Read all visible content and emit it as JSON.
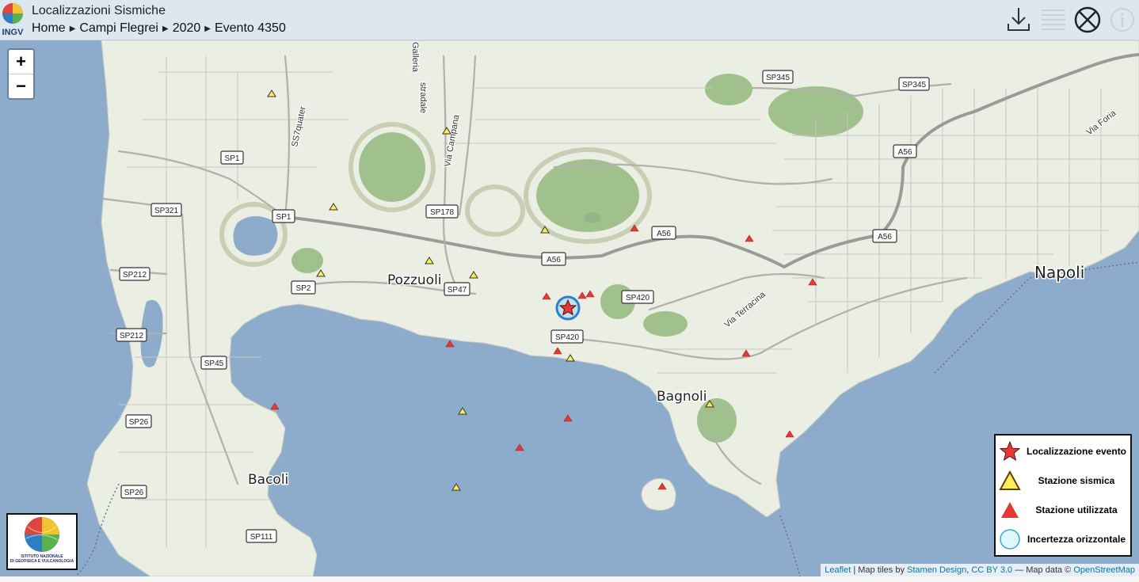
{
  "header": {
    "title": "Localizzazioni Sismiche",
    "logo_text": "INGV",
    "breadcrumb": [
      "Home",
      "Campi Flegrei",
      "2020",
      "Evento 4350"
    ],
    "icons": [
      "download-icon",
      "list-icon",
      "layers-off-icon",
      "info-icon"
    ]
  },
  "map": {
    "zoom_in": "+",
    "zoom_out": "−",
    "places": [
      "Pozzuoli",
      "Napoli",
      "Bagnoli",
      "Bacoli"
    ],
    "streets": [
      "Galleria",
      "stradale",
      "Via Campana",
      "SS7quater",
      "Via Terracina",
      "Via Foria"
    ],
    "roads": [
      "SP345",
      "SP345",
      "SP1",
      "A56",
      "SP321",
      "SP1",
      "SP178",
      "A56",
      "A56",
      "A56",
      "SP212",
      "SP2",
      "SP47",
      "SP420",
      "SP212",
      "SP420",
      "SP45",
      "SP26",
      "SP26",
      "SP111"
    ],
    "colors": {
      "sea": "#8daccb",
      "land": "#ebeee2",
      "hill": "#93b87e",
      "road": "#9a9a9a",
      "event": "#e53935",
      "station": "#ffee58",
      "used": "#e53935",
      "uncertainty": "#c7f2f7"
    }
  },
  "legend": {
    "items": [
      {
        "label": "Localizzazione evento",
        "icon": "star-icon"
      },
      {
        "label": "Stazione sismica",
        "icon": "triangle-yellow-icon"
      },
      {
        "label": "Stazione utilizzata",
        "icon": "triangle-red-icon"
      },
      {
        "label": "Incertezza orizzontale",
        "icon": "circle-icon"
      }
    ]
  },
  "institute_logo": {
    "line1": "ISTITUTO NAZIONALE",
    "line2": "DI GEOFISICA E VULCANOLOGIA"
  },
  "attribution": {
    "leaflet": "Leaflet",
    "sep1": " | Map tiles by ",
    "stamen": "Stamen Design",
    "comma": ", ",
    "license": "CC BY 3.0",
    "sep2": " — Map data © ",
    "osm": "OpenStreetMap"
  }
}
